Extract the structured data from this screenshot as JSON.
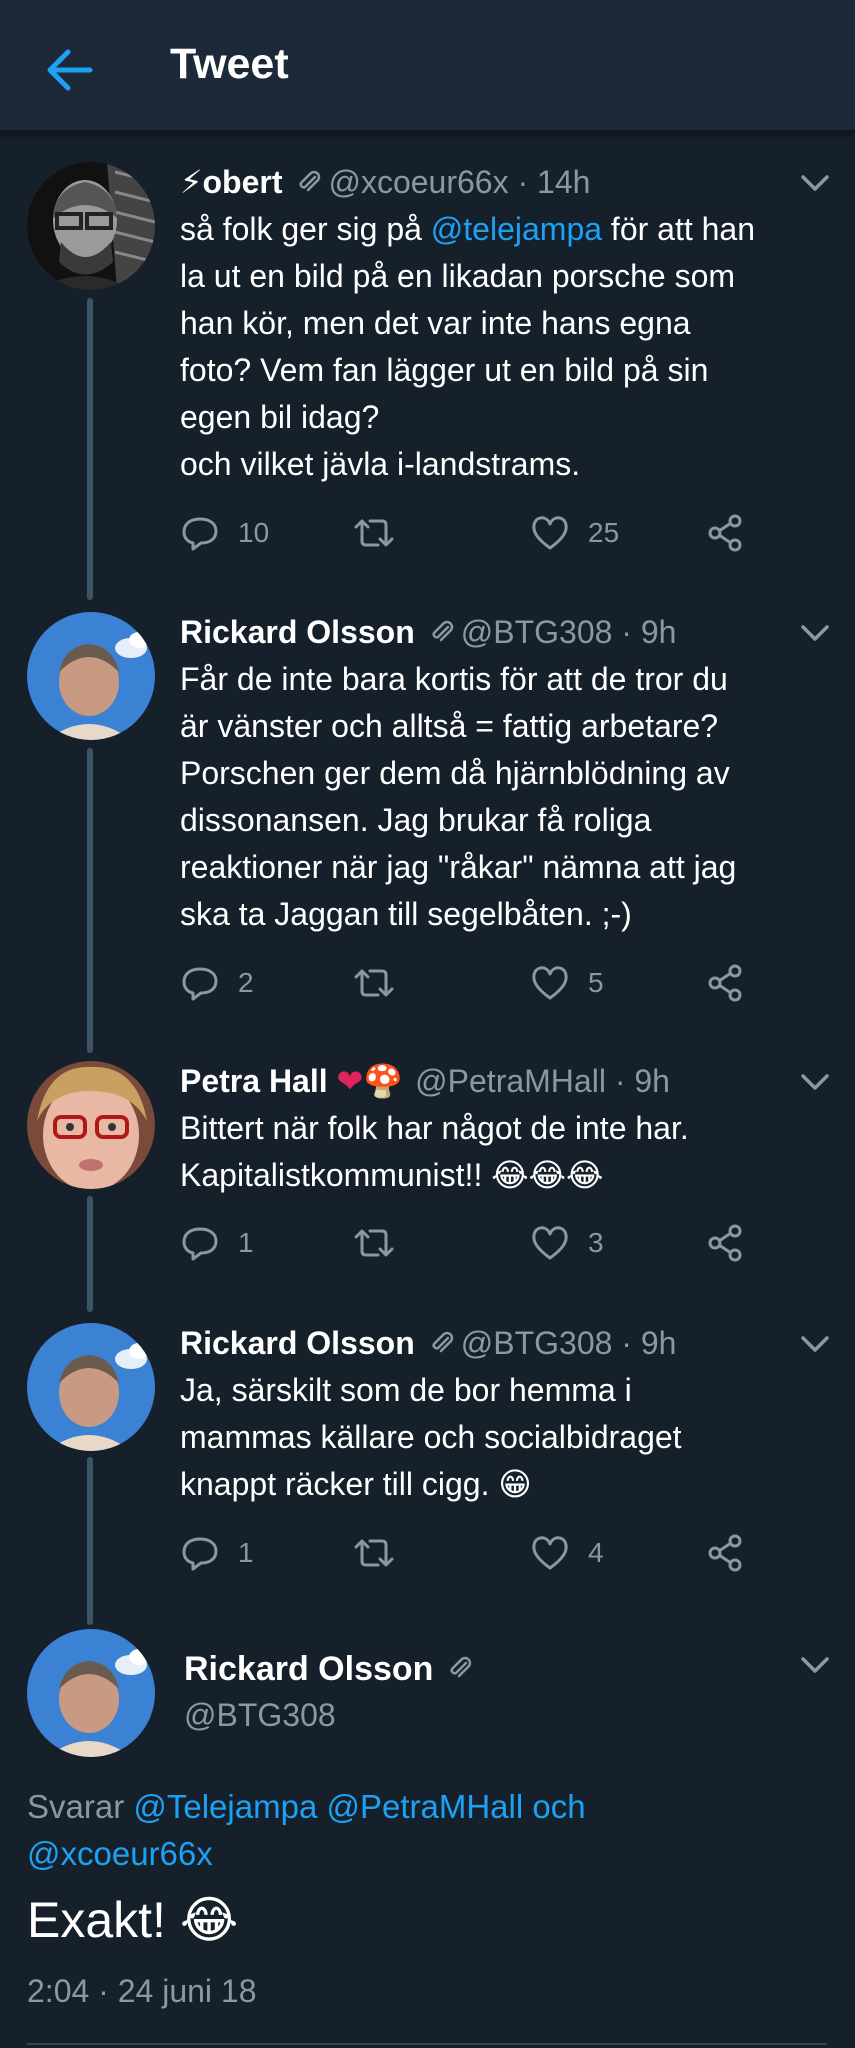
{
  "header": {
    "title": "Tweet",
    "back_icon": "arrow-left-icon",
    "accent": "#1da1f2"
  },
  "tweets": [
    {
      "display_name": "obert",
      "name_prefix_emoji": "⚡",
      "handle": "@xcoeur66x",
      "time": "14h",
      "body_before": "så folk ger sig på ",
      "mention": "@telejampa",
      "body_after": " för att han\nla ut en bild på en likadan porsche som\nhan kör, men det var inte hans egna\nfoto? Vem fan lägger ut en bild på sin\negen bil idag?\noch vilket jävla i-landstrams.",
      "replies": "10",
      "retweets": "",
      "likes": "25"
    },
    {
      "display_name": "Rickard Olsson",
      "handle": "@BTG308",
      "time": "9h",
      "body": "Får de inte bara kortis för att de tror du\när vänster och alltså = fattig arbetare?\nPorschen ger dem då hjärnblödning av\ndissonansen. Jag brukar få roliga\nreaktioner när jag \"råkar\" nämna att jag\nska ta Jaggan till segelbåten. ;-)",
      "replies": "2",
      "retweets": "",
      "likes": "5"
    },
    {
      "display_name": "Petra Hall",
      "name_suffix_emoji": "❤🍄",
      "handle": "@PetraMHall",
      "time": "9h",
      "body": "Bittert när folk har något de inte har.\nKapitalistkommunist!! ",
      "body_emoji": "😂😂😂",
      "replies": "1",
      "retweets": "",
      "likes": "3"
    },
    {
      "display_name": "Rickard Olsson",
      "handle": "@BTG308",
      "time": "9h",
      "body": "Ja, särskilt som de bor hemma i\nmammas källare och socialbidraget\nknappt räcker till cigg. ",
      "body_emoji": "😁",
      "replies": "1",
      "retweets": "",
      "likes": "4"
    }
  ],
  "main_tweet": {
    "display_name": "Rickard Olsson",
    "handle": "@BTG308",
    "reply_prefix": "Svarar ",
    "reply_mentions": "@Telejampa @PetraMHall och",
    "reply_mentions_2": "@xcoeur66x",
    "text": "Exakt! ",
    "text_emoji": "😂",
    "timestamp": "2:04 · 24 juni 18"
  },
  "colors": {
    "background": "#15202b",
    "header_bg": "#1c2938",
    "secondary_text": "#8899a6",
    "thread_line": "#3d5466",
    "link": "#1da1f2",
    "heart": "#e0245e"
  },
  "icons": [
    "arrow-left-icon",
    "paperclip-icon",
    "chevron-down-icon",
    "reply-icon",
    "retweet-icon",
    "heart-icon",
    "share-icon"
  ]
}
